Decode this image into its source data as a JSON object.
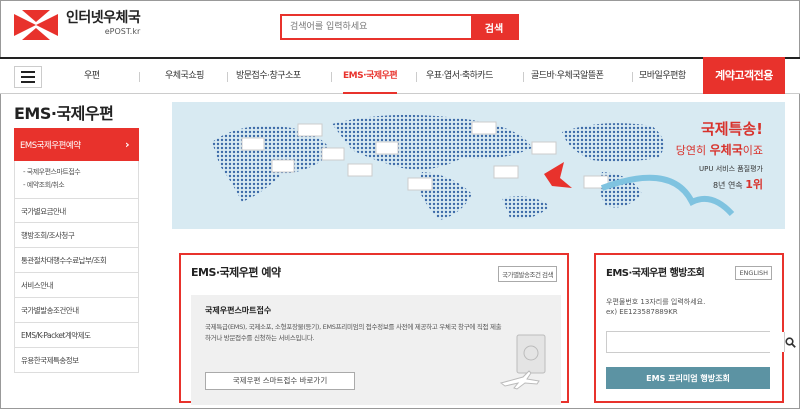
{
  "header": {
    "logo_title": "인터넷우체국",
    "logo_sub": "ePOST.kr",
    "search_placeholder": "검색어를 입력하세요",
    "search_button": "검색"
  },
  "gnb": {
    "items": [
      "우편",
      "우체국쇼핑",
      "방문접수·창구소포",
      "EMS·국제우편",
      "우표·엽서·축하카드",
      "골드바·우체국알뜰폰",
      "모바일우편함"
    ],
    "active_index": 3,
    "contract": "계약고객전용"
  },
  "lnb": {
    "title": "EMS·국제우편",
    "active": "EMS국제우편예약",
    "sub_items": [
      "- 국제우편스마트접수",
      "- 예약조회/취소"
    ],
    "items": [
      "국가별요금안내",
      "행방조회/조사청구",
      "통관절차대행수수료납부/조회",
      "서비스안내",
      "국가별발송조건안내",
      "EMS/K-Packet계약제도",
      "유용한국제특송정보"
    ]
  },
  "banner": {
    "line1": "국제특송!",
    "line2a": "당연히 ",
    "line2b": "우체국",
    "line2c": "이죠",
    "line3": "UPU 서비스 품질평가",
    "line4a": "8년 연속 ",
    "line4b": "1위"
  },
  "booking": {
    "title": "EMS·국제우편 예약",
    "link": "국가별발송조건 검색",
    "sub_title": "국제우편스마트접수",
    "desc": "국제특급(EMS), 국제소포, 소형포장물(등기), EMS프리미엄의 접수정보를 사전에 제공하고 우체국 창구에 직접 제출하거나 방문접수를 신청하는 서비스입니다.",
    "button": "국제우편 스마트접수 바로가기"
  },
  "tracking": {
    "title": "EMS·국제우편 행방조회",
    "english": "ENGLISH",
    "desc1": "우편물번호 13자리를 입력하세요.",
    "desc2": "ex) EE123587889KR",
    "button": "EMS 프리미엄 행방조회"
  },
  "colors": {
    "accent": "#e8322c",
    "button_teal": "#5c93a3"
  }
}
